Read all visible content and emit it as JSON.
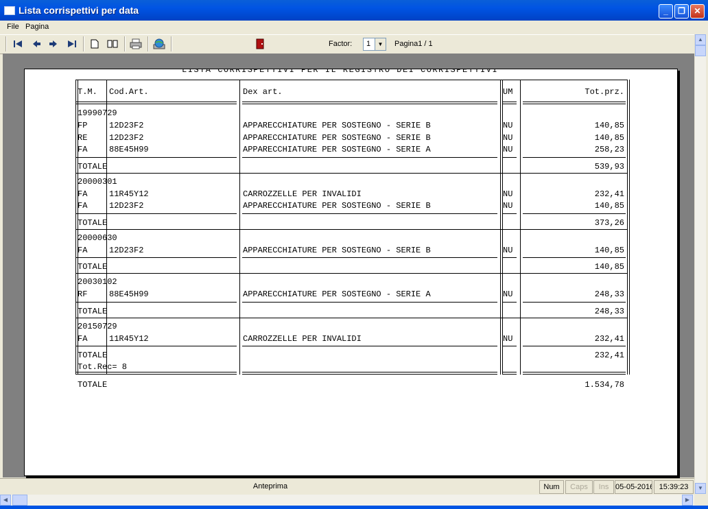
{
  "window": {
    "title": "Lista corrispettivi per data"
  },
  "menu": [
    "File",
    "Pagina"
  ],
  "toolbar": {
    "factor_label": "Factor:",
    "factor_value": "1",
    "page_label": "Pagina1 / 1"
  },
  "report": {
    "title": "LISTA CORRISPETTIVI PER IL REGISTRO DEI CORRISPETTIVI",
    "headers": {
      "tm": "T.M.",
      "cod": "Cod.Art.",
      "dex": "Dex art.",
      "um": "UM",
      "tot": "Tot.prz."
    },
    "groups": [
      {
        "date": "19990729",
        "rows": [
          {
            "tm": "FP",
            "cod": "12D23F2",
            "dex": "APPARECCHIATURE PER SOSTEGNO - SERIE B",
            "um": "NU",
            "tot": "140,85"
          },
          {
            "tm": "RE",
            "cod": "12D23F2",
            "dex": "APPARECCHIATURE PER SOSTEGNO - SERIE B",
            "um": "NU",
            "tot": "140,85"
          },
          {
            "tm": "FA",
            "cod": "88E45H99",
            "dex": "APPARECCHIATURE PER SOSTEGNO - SERIE A",
            "um": "NU",
            "tot": "258,23"
          }
        ],
        "total_label": "TOTALE",
        "total": "539,93"
      },
      {
        "date": "20000301",
        "rows": [
          {
            "tm": "FA",
            "cod": "11R45Y12",
            "dex": "CARROZZELLE PER INVALIDI",
            "um": "NU",
            "tot": "232,41"
          },
          {
            "tm": "FA",
            "cod": "12D23F2",
            "dex": "APPARECCHIATURE PER SOSTEGNO - SERIE B",
            "um": "NU",
            "tot": "140,85"
          }
        ],
        "total_label": "TOTALE",
        "total": "373,26"
      },
      {
        "date": "20000630",
        "rows": [
          {
            "tm": "FA",
            "cod": "12D23F2",
            "dex": "APPARECCHIATURE PER SOSTEGNO - SERIE B",
            "um": "NU",
            "tot": "140,85"
          }
        ],
        "total_label": "TOTALE",
        "total": "140,85"
      },
      {
        "date": "20030102",
        "rows": [
          {
            "tm": "RF",
            "cod": "88E45H99",
            "dex": "APPARECCHIATURE PER SOSTEGNO - SERIE A",
            "um": "NU",
            "tot": "248,33"
          }
        ],
        "total_label": "TOTALE",
        "total": "248,33"
      },
      {
        "date": "20150729",
        "rows": [
          {
            "tm": "FA",
            "cod": "11R45Y12",
            "dex": "CARROZZELLE PER INVALIDI",
            "um": "NU",
            "tot": "232,41"
          }
        ],
        "total_label": "TOTALE",
        "total": "232,41"
      }
    ],
    "tot_rec": "Tot.Rec= 8",
    "grand_total_label": "TOTALE",
    "grand_total": "1.534,78"
  },
  "status": {
    "mode": "Anteprima",
    "num": "Num",
    "caps": "Caps",
    "ins": "Ins",
    "date": "05-05-2016",
    "time": "15:39:23"
  }
}
